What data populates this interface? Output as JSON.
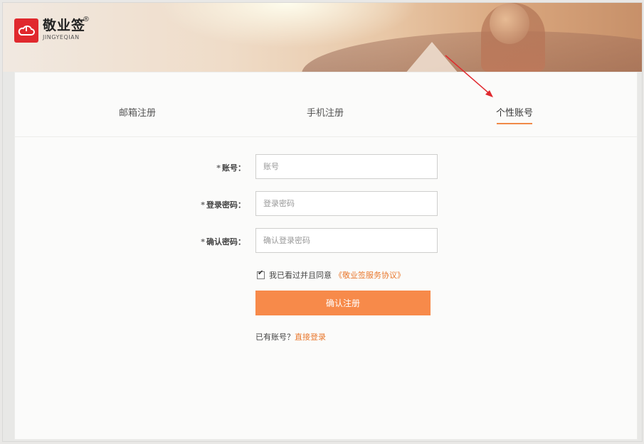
{
  "brand": {
    "name": "敬业签",
    "sub": "JINGYEQIAN",
    "reg": "®",
    "accent": "#e0292e"
  },
  "tabs": [
    {
      "label": "邮箱注册",
      "active": false
    },
    {
      "label": "手机注册",
      "active": false
    },
    {
      "label": "个性账号",
      "active": true
    }
  ],
  "form": {
    "account": {
      "required_mark": "*",
      "label": "账号：",
      "placeholder": "账号",
      "value": ""
    },
    "password": {
      "required_mark": "*",
      "label": "登录密码：",
      "placeholder": "登录密码",
      "value": ""
    },
    "confirm": {
      "required_mark": "*",
      "label": "确认密码：",
      "placeholder": "确认登录密码",
      "value": ""
    },
    "agreement": {
      "checked": true,
      "text": "我已看过并且同意",
      "link": "《敬业签服务协议》"
    },
    "submit_label": "确认注册",
    "login_prompt": "已有账号？",
    "login_link": "直接登录"
  },
  "colors": {
    "primary_button": "#f78a4a",
    "link": "#e9782d",
    "annotation_arrow": "#e0292e"
  },
  "icons": {
    "logo": "cloud-logo-icon",
    "annotation": "arrow-annotation-icon",
    "checkbox": "checkmark-icon"
  }
}
